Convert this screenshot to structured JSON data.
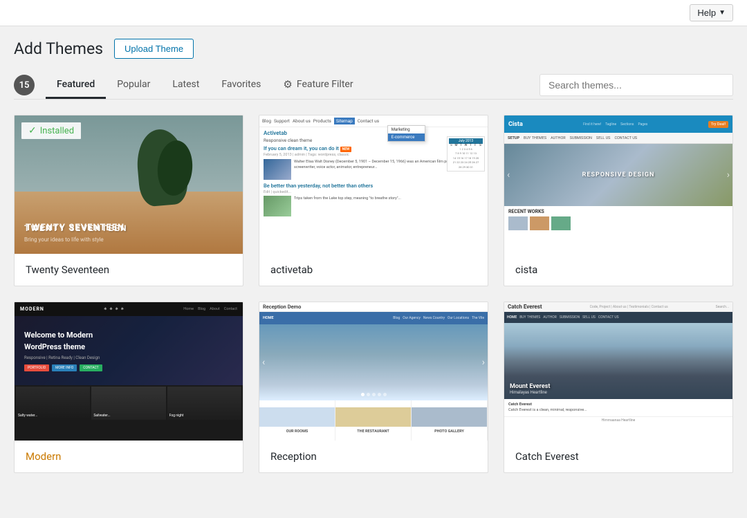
{
  "topbar": {
    "help_label": "Help",
    "chevron": "▼"
  },
  "header": {
    "title": "Add Themes",
    "upload_button": "Upload Theme"
  },
  "filter": {
    "count": "15",
    "tabs": [
      {
        "id": "featured",
        "label": "Featured",
        "active": true
      },
      {
        "id": "popular",
        "label": "Popular",
        "active": false
      },
      {
        "id": "latest",
        "label": "Latest",
        "active": false
      },
      {
        "id": "favorites",
        "label": "Favorites",
        "active": false
      }
    ],
    "feature_filter": "Feature Filter",
    "search_placeholder": "Search themes..."
  },
  "themes": [
    {
      "id": "twentyseventeen",
      "name": "Twenty Seventeen",
      "installed": true,
      "name_highlighted": false
    },
    {
      "id": "activetab",
      "name": "activetab",
      "installed": false,
      "name_highlighted": false
    },
    {
      "id": "cista",
      "name": "cista",
      "installed": false,
      "name_highlighted": false
    },
    {
      "id": "modern",
      "name": "Modern",
      "installed": false,
      "name_highlighted": true
    },
    {
      "id": "reception",
      "name": "Reception",
      "installed": false,
      "name_highlighted": false
    },
    {
      "id": "catcheverest",
      "name": "Catch Everest",
      "installed": false,
      "name_highlighted": false
    }
  ],
  "installed_label": "Installed",
  "colors": {
    "accent": "#0073aa",
    "active_tab": "#23282d",
    "installed_green": "#46b450",
    "modern_highlight": "#ca7900"
  }
}
